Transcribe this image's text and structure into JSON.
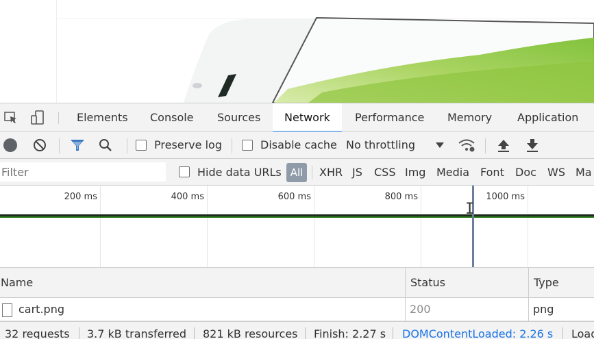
{
  "devtools": {
    "tabs": [
      "Elements",
      "Console",
      "Sources",
      "Network",
      "Performance",
      "Memory",
      "Application"
    ],
    "active_tab": "Network"
  },
  "network_toolbar": {
    "preserve_log": "Preserve log",
    "disable_cache": "Disable cache",
    "throttling": "No throttling"
  },
  "filter_bar": {
    "placeholder": "Filter",
    "hide_data_urls": "Hide data URLs",
    "types": [
      "All",
      "XHR",
      "JS",
      "CSS",
      "Img",
      "Media",
      "Font",
      "Doc",
      "WS",
      "Ma"
    ]
  },
  "timeline": {
    "ticks": [
      "200 ms",
      "400 ms",
      "600 ms",
      "800 ms",
      "1000 ms"
    ]
  },
  "table": {
    "headers": [
      "Name",
      "Status",
      "Type"
    ],
    "rows": [
      {
        "name": "cart.png",
        "status": "200",
        "type": "png"
      }
    ]
  },
  "status_bar": {
    "requests": "32 requests",
    "transferred": "3.7 kB transferred",
    "resources": "821 kB resources",
    "finish": "Finish: 2.27 s",
    "dom_content_loaded": "DOMContentLoaded: 2.26 s",
    "load": "Load"
  },
  "colors": {
    "accent": "#1a73e8",
    "toolbar_bg": "#f3f3f3",
    "all_button_bg": "#8f9ba8",
    "timeline_green": "#2c7a1e"
  }
}
